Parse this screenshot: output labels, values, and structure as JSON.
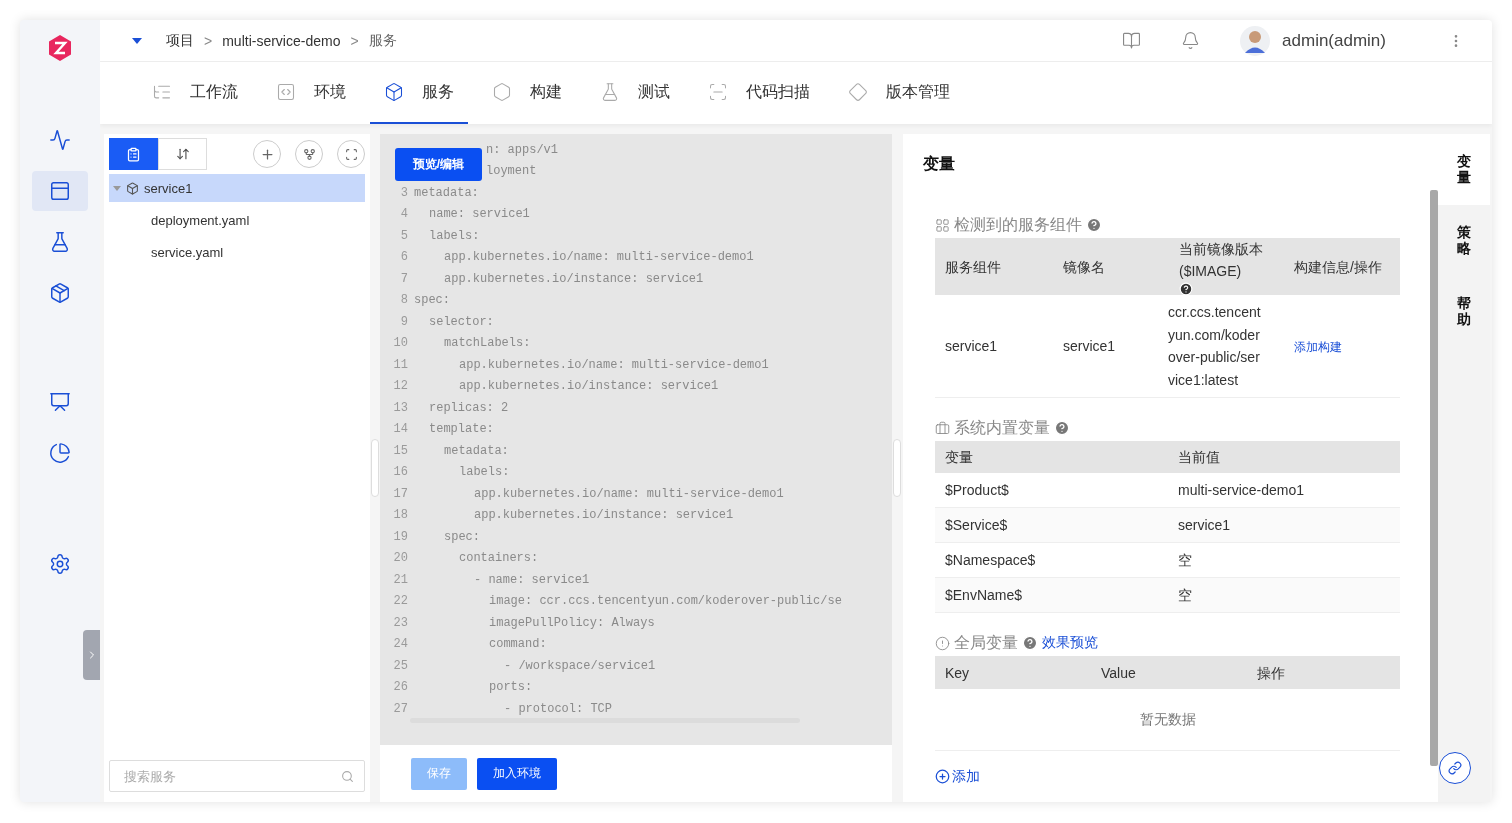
{
  "sidebar": {
    "items": [
      {
        "selected": false
      },
      {
        "selected": true
      },
      {
        "selected": false
      },
      {
        "selected": false
      },
      {
        "selected": false
      },
      {
        "selected": false
      },
      {
        "selected": false
      }
    ]
  },
  "breadcrumb": [
    {
      "kind": "link",
      "label": "项目"
    },
    {
      "kind": "sep",
      "label": ">"
    },
    {
      "kind": "link",
      "label": "multi-service-demo"
    },
    {
      "kind": "sep",
      "label": ">"
    },
    {
      "kind": "current",
      "label": "服务"
    }
  ],
  "user": {
    "name": "admin(admin)"
  },
  "nav_tabs": [
    {
      "label": "工作流",
      "selected": false
    },
    {
      "label": "环境",
      "selected": false
    },
    {
      "label": "服务",
      "selected": true
    },
    {
      "label": "构建",
      "selected": false
    },
    {
      "label": "测试",
      "selected": false
    },
    {
      "label": "代码扫描",
      "selected": false
    },
    {
      "label": "版本管理",
      "selected": false
    }
  ],
  "file_panel": {
    "tools": [
      {
        "selected": true
      },
      {
        "selected": false
      }
    ],
    "tree": [
      {
        "label": "service1",
        "selected": true,
        "expanded": true,
        "children": [
          {
            "label": "deployment.yaml",
            "selected": false
          },
          {
            "label": "service.yaml",
            "selected": false
          }
        ]
      }
    ],
    "search": {
      "placeholder": "搜索服务"
    }
  },
  "editor": {
    "overlay_button": "预览/编辑",
    "lines": [
      {
        "text": "n: apps/v1"
      },
      {
        "text": "loyment"
      },
      {
        "number": "3",
        "text": "metadata:",
        "children": [
          {
            "number": "4",
            "text": "name: service1"
          },
          {
            "number": "5",
            "text": "labels:",
            "children": [
              {
                "number": "6",
                "text": "app.kubernetes.io/name: multi-service-demo1"
              },
              {
                "number": "7",
                "text": "app.kubernetes.io/instance: service1"
              }
            ]
          }
        ]
      },
      {
        "number": "8",
        "text": "spec:",
        "children": [
          {
            "number": "9",
            "text": "selector:",
            "children": [
              {
                "number": "10",
                "text": "matchLabels:",
                "children": [
                  {
                    "number": "11",
                    "text": "app.kubernetes.io/name: multi-service-demo1"
                  },
                  {
                    "number": "12",
                    "text": "app.kubernetes.io/instance: service1"
                  }
                ]
              }
            ]
          },
          {
            "number": "13",
            "text": "replicas: 2"
          },
          {
            "number": "14",
            "text": "template:",
            "children": [
              {
                "number": "15",
                "text": "metadata:",
                "children": [
                  {
                    "number": "16",
                    "text": "labels:",
                    "children": [
                      {
                        "number": "17",
                        "text": "app.kubernetes.io/name: multi-service-demo1"
                      },
                      {
                        "number": "18",
                        "text": "app.kubernetes.io/instance: service1"
                      }
                    ]
                  }
                ]
              },
              {
                "number": "19",
                "text": "spec:",
                "children": [
                  {
                    "number": "20",
                    "text": "containers:",
                    "children": [
                      {
                        "number": "21",
                        "text": "- name: service1",
                        "children": [
                          {
                            "number": "22",
                            "text": "image: ccr.ccs.tencentyun.com/koderover-public/se"
                          },
                          {
                            "number": "23",
                            "text": "imagePullPolicy: Always"
                          },
                          {
                            "number": "24",
                            "text": "command:",
                            "children": [
                              {
                                "number": "25",
                                "text": "- /workspace/service1"
                              }
                            ]
                          },
                          {
                            "number": "26",
                            "text": "ports:",
                            "children": [
                              {
                                "number": "27",
                                "text": "- protocol: TCP"
                              }
                            ]
                          }
                        ]
                      }
                    ]
                  }
                ]
              }
            ]
          }
        ]
      }
    ],
    "buttons": [
      {
        "label": "保存",
        "disabled": true
      },
      {
        "label": "加入环境",
        "disabled": false
      }
    ]
  },
  "variables": {
    "title": "变量",
    "components": {
      "title": "检测到的服务组件",
      "columns": [
        "服务组件",
        "镜像名",
        "当前镜像版本 ($IMAGE)",
        "构建信息/操作"
      ],
      "rows": [
        {
          "component": "service1",
          "image_name": "service1",
          "image": "ccr.ccs.tencentyun.com/koderover-public/service1:latest",
          "action": "添加构建"
        }
      ]
    },
    "builtin": {
      "title": "系统内置变量",
      "columns": [
        "变量",
        "当前值"
      ],
      "rows": [
        [
          "$Product$",
          "multi-service-demo1"
        ],
        [
          "$Service$",
          "service1"
        ],
        [
          "$Namespace$",
          "空"
        ],
        [
          "$EnvName$",
          "空"
        ]
      ]
    },
    "global": {
      "title": "全局变量",
      "link": "效果预览",
      "columns": [
        "Key",
        "Value",
        "操作"
      ],
      "empty": "暂无数据",
      "add": "添加"
    }
  },
  "side_tabs": [
    {
      "label": "变量",
      "selected": true
    },
    {
      "label": "策略",
      "selected": false
    },
    {
      "label": "帮助",
      "selected": false
    }
  ]
}
